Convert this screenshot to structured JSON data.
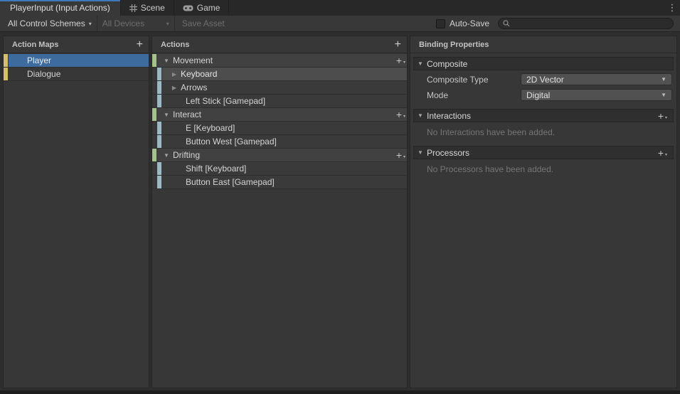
{
  "colors": {
    "accent_blue": "#3e78b8",
    "selection_blue": "#3d6b9e",
    "action_map_strip": "#d6be6b",
    "action_strip": "#a4c28e",
    "binding_strip": "#9bb8c3",
    "panel_background": "#373737",
    "empty_text": "#757575"
  },
  "tab_bar": {
    "tabs": [
      {
        "label": "PlayerInput (Input Actions)",
        "active": true,
        "icon": null
      },
      {
        "label": "Scene",
        "active": false,
        "icon": "grid"
      },
      {
        "label": "Game",
        "active": false,
        "icon": "gamepad"
      }
    ],
    "menu_icon": "⋮"
  },
  "toolbar": {
    "control_schemes_label": "All Control Schemes",
    "devices_label": "All Devices",
    "save_asset_label": "Save Asset",
    "auto_save_label": "Auto-Save",
    "auto_save_checked": false,
    "search_value": "",
    "search_placeholder": ""
  },
  "action_maps": {
    "title": "Action Maps",
    "add_icon": "+",
    "items": [
      {
        "label": "Player",
        "selected": true
      },
      {
        "label": "Dialogue",
        "selected": false
      }
    ]
  },
  "actions": {
    "title": "Actions",
    "add_icon": "+",
    "rows": [
      {
        "type": "action",
        "label": "Movement",
        "expanded": true,
        "selected": false
      },
      {
        "type": "composite",
        "label": "Keyboard",
        "expanded": false,
        "selected": true
      },
      {
        "type": "composite",
        "label": "Arrows",
        "expanded": false,
        "selected": false
      },
      {
        "type": "binding",
        "label": "Left Stick [Gamepad]",
        "expanded": null,
        "selected": false
      },
      {
        "type": "action",
        "label": "Interact",
        "expanded": true,
        "selected": false
      },
      {
        "type": "binding",
        "label": "E [Keyboard]",
        "expanded": null,
        "selected": false
      },
      {
        "type": "binding",
        "label": "Button West [Gamepad]",
        "expanded": null,
        "selected": false
      },
      {
        "type": "action",
        "label": "Drifting",
        "expanded": true,
        "selected": false
      },
      {
        "type": "binding",
        "label": "Shift [Keyboard]",
        "expanded": null,
        "selected": false
      },
      {
        "type": "binding",
        "label": "Button East [Gamepad]",
        "expanded": null,
        "selected": false
      }
    ]
  },
  "binding_properties": {
    "title": "Binding Properties",
    "composite": {
      "title": "Composite",
      "fields": [
        {
          "label": "Composite Type",
          "value": "2D Vector"
        },
        {
          "label": "Mode",
          "value": "Digital"
        }
      ]
    },
    "interactions": {
      "title": "Interactions",
      "empty_message": "No Interactions have been added."
    },
    "processors": {
      "title": "Processors",
      "empty_message": "No Processors have been added."
    }
  },
  "icons": {
    "fold_open": "▼",
    "fold_closed": "▶",
    "dropdown_arrow": "▼",
    "caret_small": "▾",
    "plus": "+",
    "kebab": "⋮"
  }
}
